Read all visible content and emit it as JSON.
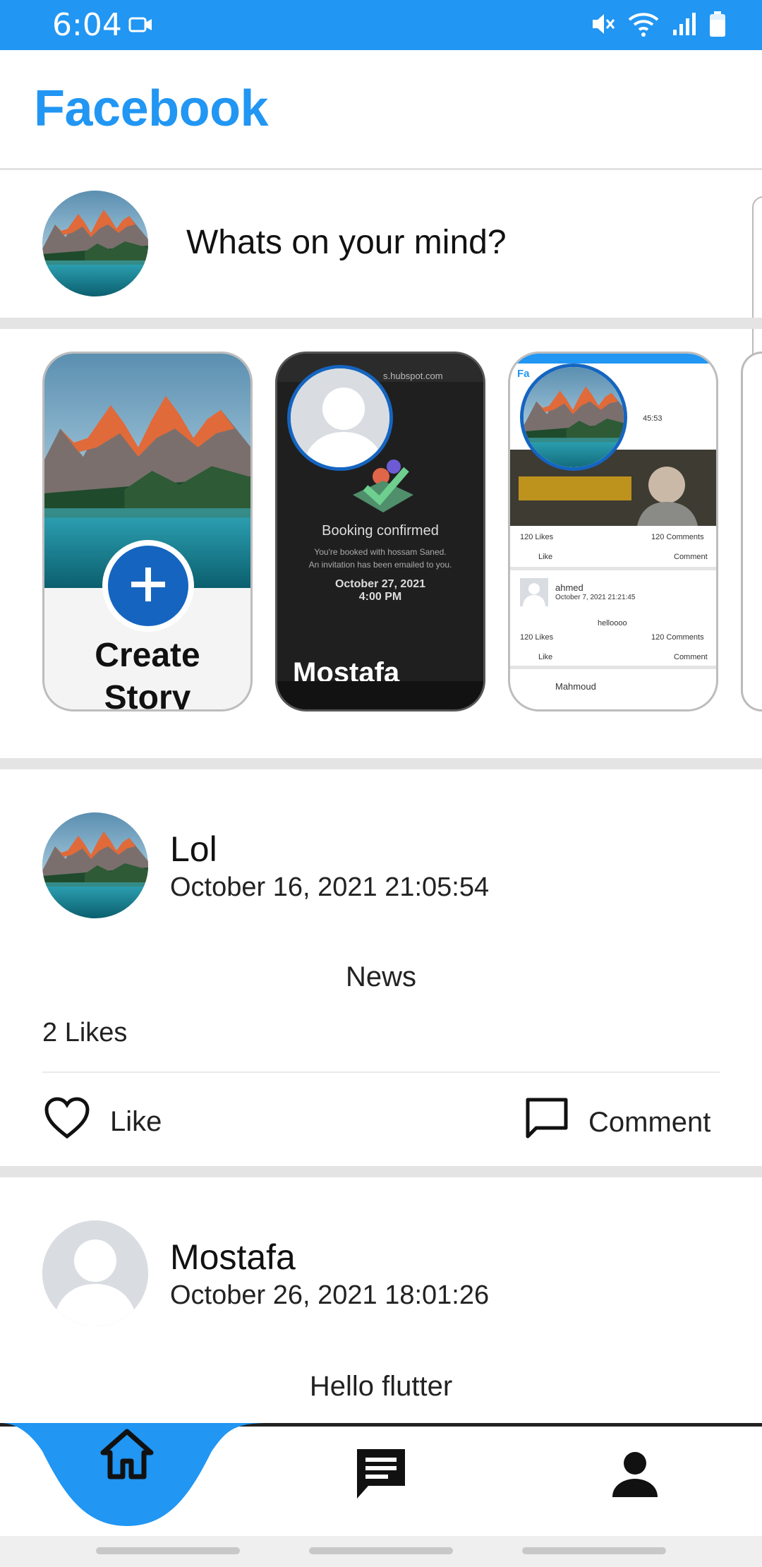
{
  "status_bar": {
    "time": "6:04",
    "icons": [
      "video-camera-icon",
      "mute-icon",
      "wifi-icon",
      "signal-icon",
      "battery-icon"
    ]
  },
  "app_bar": {
    "title": "Facebook"
  },
  "composer": {
    "placeholder": "Whats on your mind?"
  },
  "stories": {
    "create_label_line1": "Create",
    "create_label_line2": "Story",
    "items": [
      {
        "name": "Mostafa",
        "preview": {
          "url": "s.hubspot.com",
          "heading": "Booking confirmed",
          "line1": "You're booked with hossam Saned.",
          "line2": "An invitation has been emailed to you.",
          "date": "October 27, 2021",
          "time": "4:00 PM"
        }
      },
      {
        "name": "",
        "preview": {
          "app_initial": "Fa",
          "timestamp": "45:53",
          "likes": "120 Likes",
          "comments": "120 Comments",
          "like": "Like",
          "comment": "Comment",
          "post2_author": "ahmed",
          "post2_date": "October 7, 2021 21:21:45",
          "post2_text": "helloooo",
          "post3_author": "Mahmoud"
        }
      }
    ]
  },
  "posts": [
    {
      "author": "Lol",
      "date": "October 16, 2021 21:05:54",
      "text": "News",
      "likes": "2 Likes",
      "like_label": "Like",
      "comment_label": "Comment"
    },
    {
      "author": "Mostafa",
      "date": "October 26, 2021 18:01:26",
      "text": "Hello flutter"
    }
  ],
  "bottom_nav": {
    "items": [
      "home-icon",
      "chat-icon",
      "person-icon"
    ],
    "active": "home-icon"
  },
  "colors": {
    "primary": "#2196F3",
    "accent_dark": "#1565C0",
    "divider": "#e4e4e4"
  }
}
